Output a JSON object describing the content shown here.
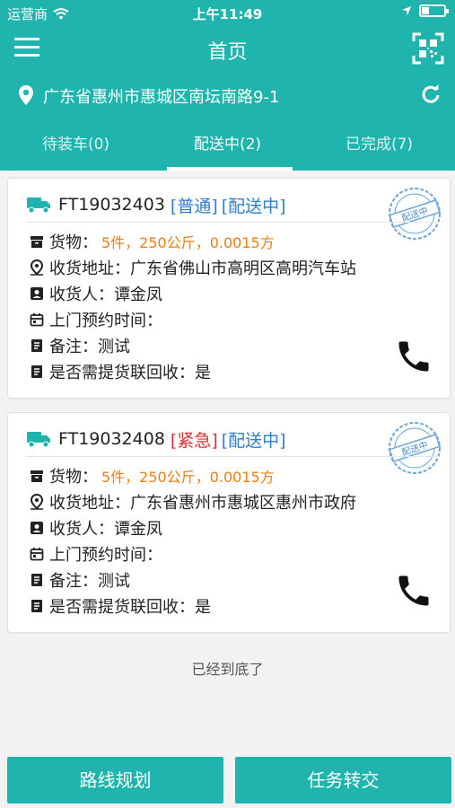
{
  "status_bar": {
    "carrier": "运营商",
    "time": "上午11:49"
  },
  "header": {
    "title": "首页"
  },
  "location": {
    "address": "广东省惠州市惠城区南坛南路9-1"
  },
  "tabs": [
    {
      "label": "待装车(0)",
      "active": false
    },
    {
      "label": "配送中(2)",
      "active": true
    },
    {
      "label": "已完成(7)",
      "active": false
    }
  ],
  "orders": [
    {
      "number": "FT19032403",
      "priority": "[普通]",
      "status": "[配送中]",
      "stamp_text": "配送中",
      "goods_label": "货物：",
      "goods_value": "5件，250公斤，0.0015方",
      "address_label": "收货地址：",
      "address_value": "广东省佛山市高明区高明汽车站",
      "receiver_label": "收货人：",
      "receiver_value": "谭金凤",
      "appointment_label": "上门预约时间：",
      "appointment_value": "",
      "remark_label": "备注：",
      "remark_value": "测试",
      "recycle_label": "是否需提货联回收：",
      "recycle_value": "是"
    },
    {
      "number": "FT19032408",
      "priority": "[紧急]",
      "status": "[配送中]",
      "stamp_text": "配送中",
      "goods_label": "货物：",
      "goods_value": "5件，250公斤，0.0015方",
      "address_label": "收货地址：",
      "address_value": "广东省惠州市惠城区惠州市政府",
      "receiver_label": "收货人：",
      "receiver_value": "谭金凤",
      "appointment_label": "上门预约时间：",
      "appointment_value": "",
      "remark_label": "备注：",
      "remark_value": "测试",
      "recycle_label": "是否需提货联回收：",
      "recycle_value": "是"
    }
  ],
  "list_end_text": "已经到底了",
  "actions": {
    "route_planning": "路线规划",
    "task_transfer": "任务转交"
  },
  "colors": {
    "primary": "#1fb5ae",
    "normal_tag": "#2d7dd2",
    "urgent_tag": "#d9302f",
    "goods_highlight": "#f07d12"
  }
}
